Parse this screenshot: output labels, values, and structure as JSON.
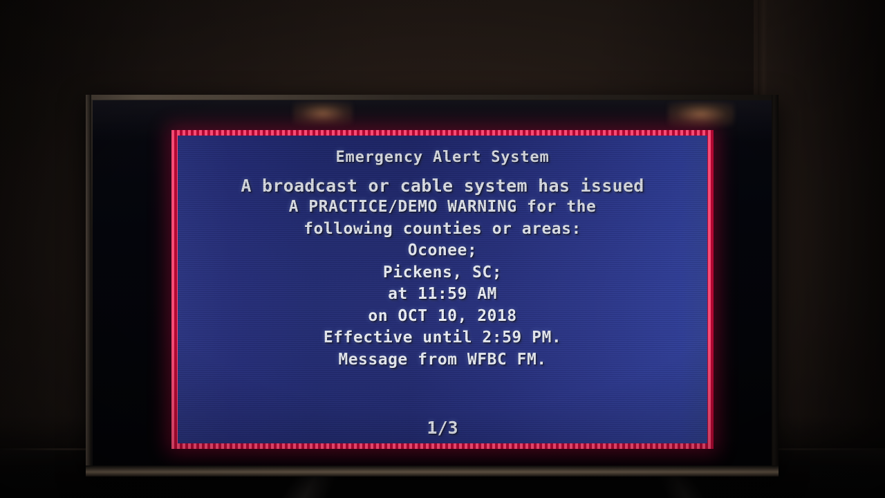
{
  "scene": {
    "device": "television",
    "background_color": "#241b16",
    "screen_color": "#04050b"
  },
  "alert": {
    "border_color": "#e8104a",
    "background_color": "#243080",
    "text_color": "#eef2fb",
    "title": "Emergency Alert System",
    "lines": [
      "A broadcast or cable system has issued",
      "A PRACTICE/DEMO WARNING for the",
      "following counties or areas:",
      "Oconee;",
      "Pickens, SC;",
      "at 11:59 AM",
      "on OCT 10, 2018",
      "Effective until 2:59 PM.",
      "Message from WFBC FM."
    ],
    "page_indicator": "1/3"
  }
}
